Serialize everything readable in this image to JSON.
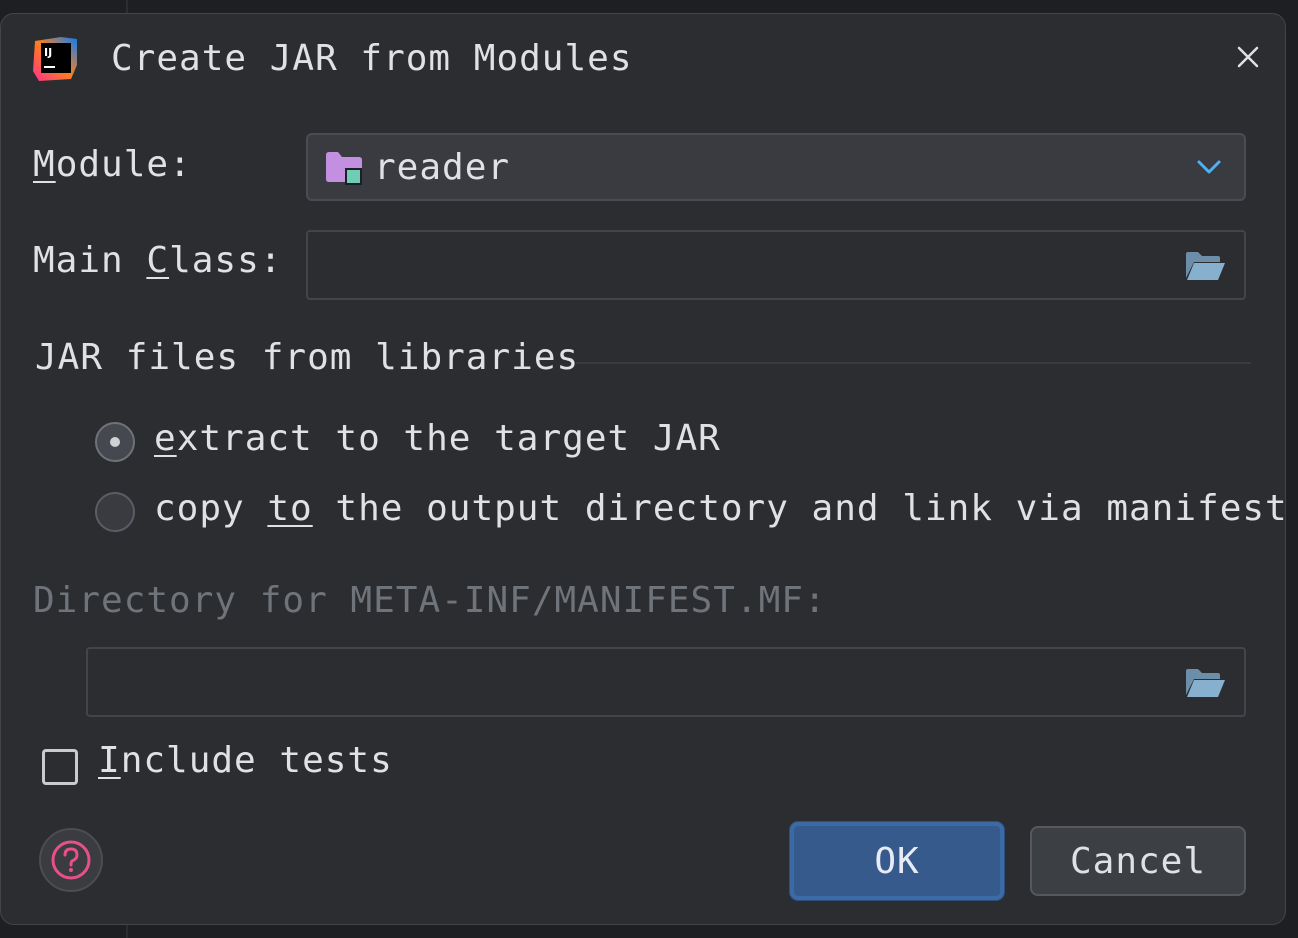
{
  "dialog": {
    "title": "Create JAR from Modules",
    "app_icon": "intellij-idea-icon",
    "close_icon": "close-icon"
  },
  "module": {
    "label_prefix": "",
    "label_accel": "M",
    "label_rest": "odule:",
    "value": "reader",
    "icon": "module-folder-icon",
    "dropdown_icon": "chevron-down-icon"
  },
  "main_class": {
    "label_prefix": "Main ",
    "label_accel": "C",
    "label_rest": "lass:",
    "value": "",
    "browse_icon": "folder-open-icon"
  },
  "jar_libraries": {
    "group_title": "JAR files from libraries",
    "options": [
      {
        "prefix": "",
        "accel": "e",
        "rest": "xtract to the target JAR",
        "selected": true
      },
      {
        "prefix": "copy ",
        "accel": "to",
        "rest": " the output directory and link via manifest",
        "selected": false
      }
    ]
  },
  "manifest_dir": {
    "label": "Directory for META-INF/MANIFEST.MF:",
    "value": "",
    "enabled": false,
    "browse_icon": "folder-open-icon"
  },
  "include_tests": {
    "accel": "I",
    "rest": "nclude tests",
    "checked": false
  },
  "buttons": {
    "help_icon": "help-icon",
    "ok_label": "OK",
    "cancel_label": "Cancel"
  },
  "colors": {
    "accent": "#3574f0",
    "ok_button": "#375a8c",
    "dialog_bg": "#2b2d30",
    "help_icon": "#e8508b",
    "chevron": "#4eb1f5"
  }
}
